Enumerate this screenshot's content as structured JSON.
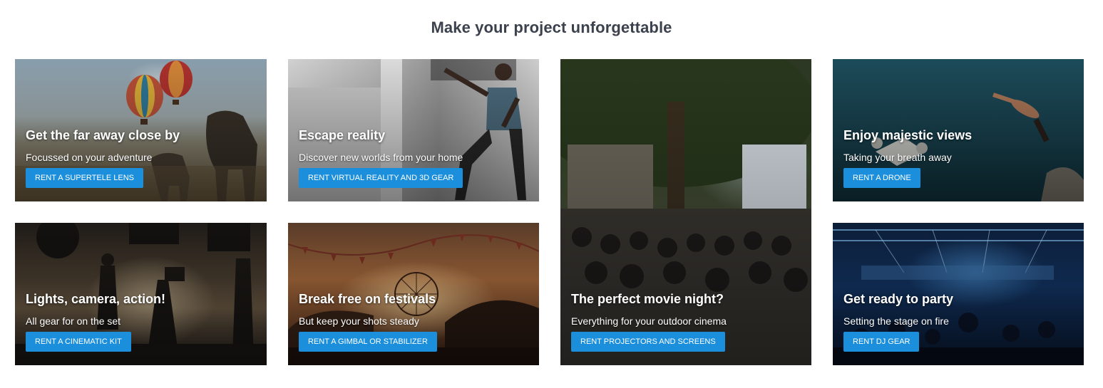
{
  "heading": "Make your project unforgettable",
  "cards": [
    {
      "title": "Get the far away close by",
      "subtitle": "Focussed on your adventure",
      "cta": "RENT A SUPERTELE LENS"
    },
    {
      "title": "Escape reality",
      "subtitle": "Discover new worlds from your home",
      "cta": "RENT VIRTUAL REALITY AND 3D GEAR"
    },
    {
      "title": "The perfect movie night?",
      "subtitle": "Everything for your outdoor cinema",
      "cta": "RENT PROJECTORS AND SCREENS"
    },
    {
      "title": "Enjoy majestic views",
      "subtitle": "Taking your breath away",
      "cta": "RENT A DRONE"
    },
    {
      "title": "Lights, camera, action!",
      "subtitle": "All gear for on the set",
      "cta": "RENT A CINEMATIC KIT"
    },
    {
      "title": "Break free on festivals",
      "subtitle": "But keep your shots steady",
      "cta": "RENT A GIMBAL OR STABILIZER"
    },
    {
      "title": "Get ready to party",
      "subtitle": "Setting the stage on fire",
      "cta": "RENT DJ GEAR"
    }
  ],
  "colors": {
    "heading_text": "#3b414d",
    "button_bg": "#1b8fdc",
    "button_text": "#ffffff"
  }
}
